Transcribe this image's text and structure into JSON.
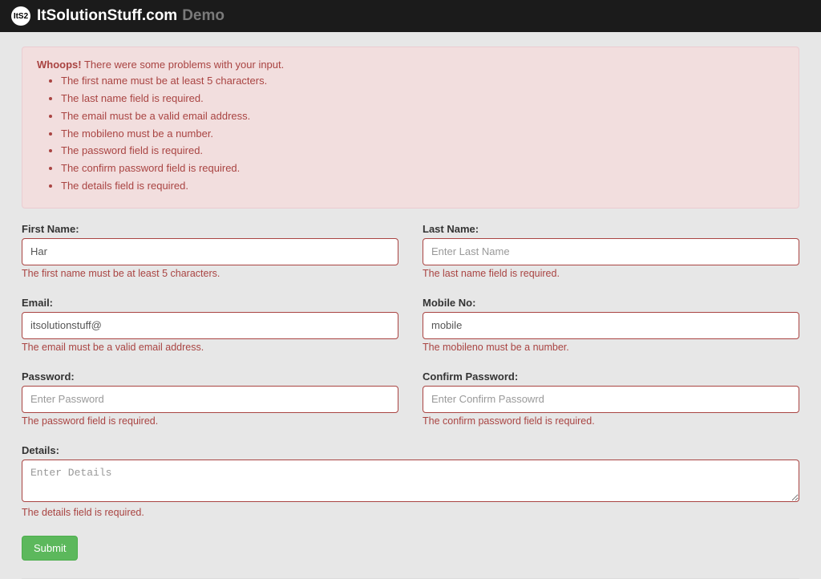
{
  "navbar": {
    "logo_text": "ItS2",
    "title": "ItSolutionStuff.com",
    "sub": "Demo"
  },
  "alert": {
    "strong": "Whoops!",
    "intro": " There were some problems with your input.",
    "items": [
      "The first name must be at least 5 characters.",
      "The last name field is required.",
      "The email must be a valid email address.",
      "The mobileno must be a number.",
      "The password field is required.",
      "The confirm password field is required.",
      "The details field is required."
    ]
  },
  "fields": {
    "first_name": {
      "label": "First Name:",
      "value": "Har",
      "placeholder": "",
      "error": "The first name must be at least 5 characters."
    },
    "last_name": {
      "label": "Last Name:",
      "value": "",
      "placeholder": "Enter Last Name",
      "error": "The last name field is required."
    },
    "email": {
      "label": "Email:",
      "value": "itsolutionstuff@",
      "placeholder": "",
      "error": "The email must be a valid email address."
    },
    "mobile": {
      "label": "Mobile No:",
      "value": "mobile",
      "placeholder": "",
      "error": "The mobileno must be a number."
    },
    "password": {
      "label": "Password:",
      "value": "",
      "placeholder": "Enter Password",
      "error": "The password field is required."
    },
    "confirm_password": {
      "label": "Confirm Password:",
      "value": "",
      "placeholder": "Enter Confirm Passowrd",
      "error": "The confirm password field is required."
    },
    "details": {
      "label": "Details:",
      "value": "",
      "placeholder": "Enter Details",
      "error": "The details field is required."
    }
  },
  "submit": {
    "label": "Submit"
  }
}
